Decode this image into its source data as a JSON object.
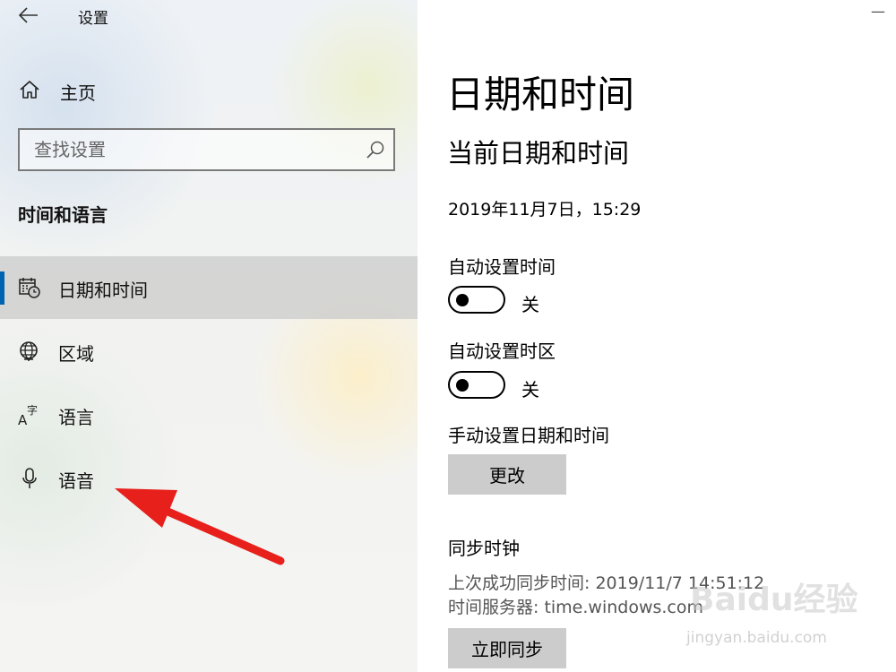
{
  "window": {
    "title": "设置"
  },
  "sidebar": {
    "home_label": "主页",
    "search_placeholder": "查找设置",
    "section_title": "时间和语言",
    "items": [
      {
        "label": "日期和时间",
        "icon": "calendar-clock-icon",
        "selected": true
      },
      {
        "label": "区域",
        "icon": "globe-icon",
        "selected": false
      },
      {
        "label": "语言",
        "icon": "language-icon",
        "selected": false
      },
      {
        "label": "语音",
        "icon": "microphone-icon",
        "selected": false
      }
    ],
    "language_icon_glyphs": {
      "latin": "A",
      "cjk": "字"
    }
  },
  "main": {
    "page_title": "日期和时间",
    "subtitle": "当前日期和时间",
    "current_datetime": "2019年11月7日，15:29",
    "auto_time": {
      "label": "自动设置时间",
      "state": "关"
    },
    "auto_timezone": {
      "label": "自动设置时区",
      "state": "关"
    },
    "manual": {
      "label": "手动设置日期和时间",
      "button": "更改"
    },
    "sync": {
      "title": "同步时钟",
      "last_sync": "上次成功同步时间: 2019/11/7 14:51:12",
      "server": "时间服务器: time.windows.com",
      "button": "立即同步"
    }
  },
  "watermark": {
    "main": "Baidu经验",
    "sub": "jingyan.baidu.com"
  },
  "colors": {
    "accent": "#0063b1",
    "annotation_arrow": "#e8201c",
    "button_bg": "#cccccc",
    "selected_bg": "#cdcdcd"
  }
}
